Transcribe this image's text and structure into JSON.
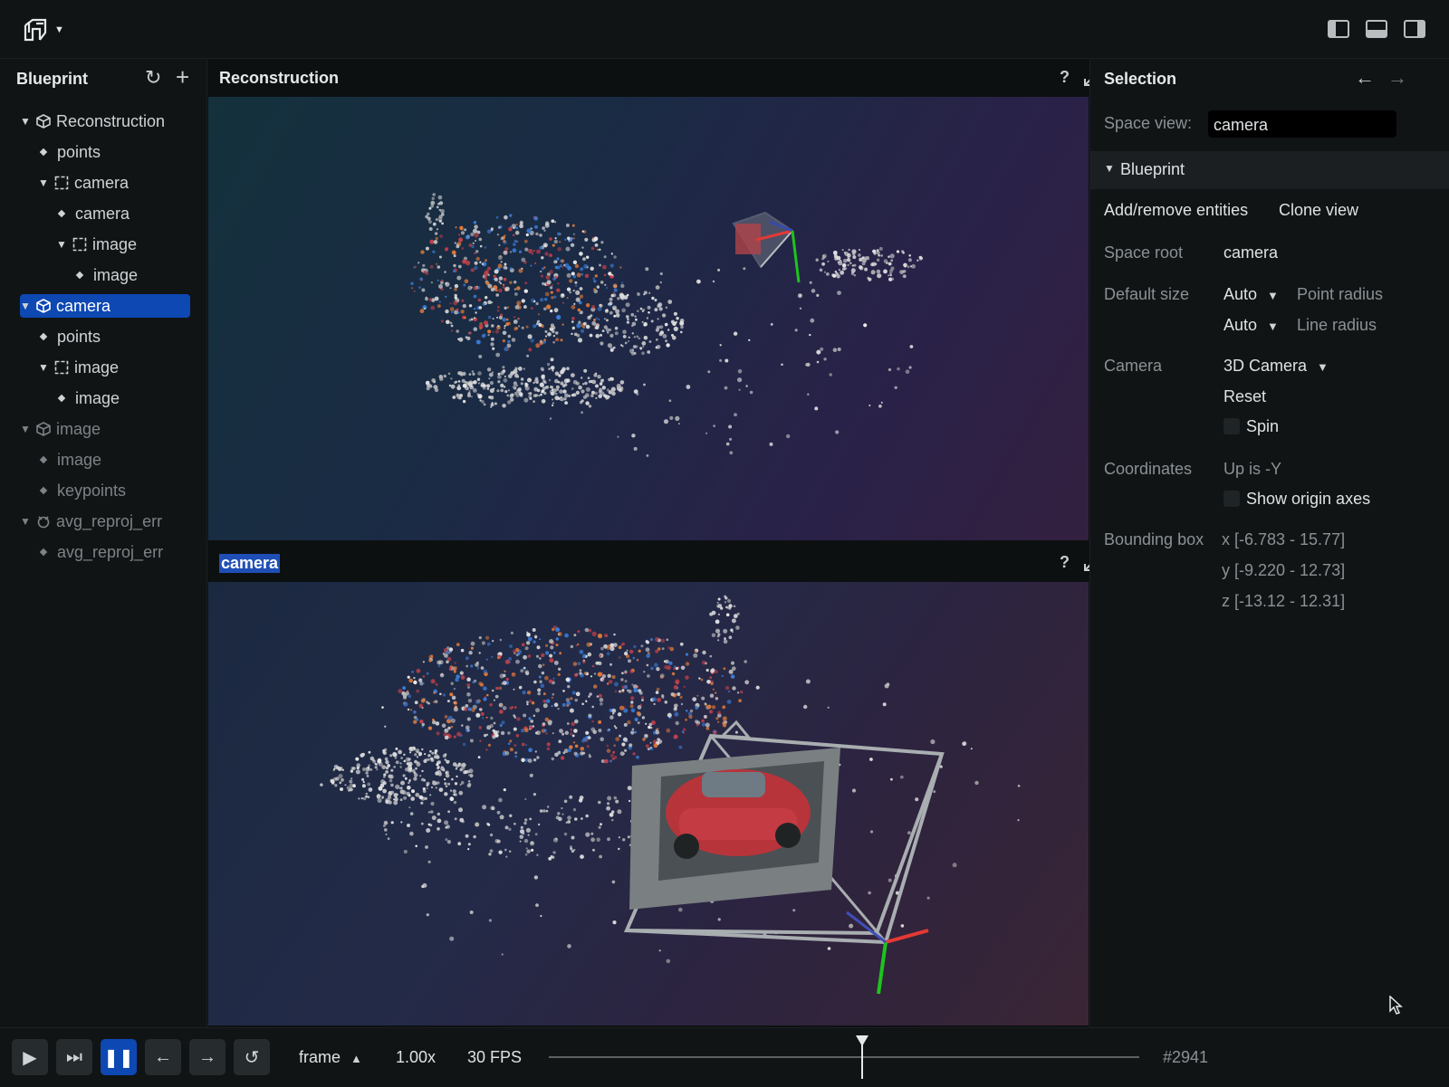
{
  "colors": {
    "accent": "#0d48b3",
    "panel": "#111415",
    "text": "#cfd3d6",
    "dim": "#7c8286"
  },
  "left": {
    "title": "Blueprint",
    "tree": [
      {
        "label": "Reconstruction",
        "icon": "cube-icon",
        "expanded": true,
        "depth": 0,
        "dim": false
      },
      {
        "label": "points",
        "icon": "entity-dot-icon",
        "depth": 1,
        "dim": false
      },
      {
        "label": "camera",
        "icon": "frame-icon",
        "expanded": true,
        "depth": 1,
        "dim": false
      },
      {
        "label": "camera",
        "icon": "entity-dot-icon",
        "depth": 2,
        "dim": false
      },
      {
        "label": "image",
        "icon": "frame-icon",
        "expanded": true,
        "depth": 2,
        "dim": false
      },
      {
        "label": "image",
        "icon": "entity-dot-icon",
        "depth": 3,
        "dim": false
      },
      {
        "label": "camera",
        "icon": "cube-icon",
        "expanded": true,
        "depth": 0,
        "dim": false,
        "selected": true
      },
      {
        "label": "points",
        "icon": "entity-dot-icon",
        "depth": 1,
        "dim": false
      },
      {
        "label": "image",
        "icon": "frame-icon",
        "expanded": true,
        "depth": 1,
        "dim": false
      },
      {
        "label": "image",
        "icon": "entity-dot-icon",
        "depth": 2,
        "dim": false
      },
      {
        "label": "image",
        "icon": "cube-icon",
        "expanded": true,
        "depth": 0,
        "dim": true
      },
      {
        "label": "image",
        "icon": "entity-dot-icon",
        "depth": 1,
        "dim": true
      },
      {
        "label": "keypoints",
        "icon": "entity-dot-icon",
        "depth": 1,
        "dim": true
      },
      {
        "label": "avg_reproj_err",
        "icon": "chart-icon",
        "expanded": true,
        "depth": 0,
        "dim": true
      },
      {
        "label": "avg_reproj_err",
        "icon": "entity-dot-icon",
        "depth": 1,
        "dim": true
      }
    ]
  },
  "views": {
    "top": {
      "title": "Reconstruction",
      "help": "?"
    },
    "bottom": {
      "title": "camera",
      "help": "?"
    }
  },
  "right": {
    "title": "Selection",
    "space_view_label": "Space view:",
    "space_view_value": "camera",
    "section": "Blueprint",
    "add_remove": "Add/remove entities",
    "clone": "Clone view",
    "space_root_label": "Space root",
    "space_root_value": "camera",
    "default_size_label": "Default size",
    "point_size": "Auto",
    "point_radius_label": "Point radius",
    "line_size": "Auto",
    "line_radius_label": "Line radius",
    "camera_label": "Camera",
    "camera_value": "3D Camera",
    "reset": "Reset",
    "spin": "Spin",
    "coordinates_label": "Coordinates",
    "coordinates_value": "Up is -Y",
    "origin_axes": "Show origin axes",
    "bbox_label": "Bounding box",
    "bbox_x": "x [-6.783 - 15.77]",
    "bbox_y": "y [-9.220 - 12.73]",
    "bbox_z": "z [-13.12 - 12.31]"
  },
  "bottom": {
    "timeline": "frame",
    "speed": "1.00x",
    "fps": "30 FPS",
    "frame": "#2941",
    "progress": 0.53
  }
}
